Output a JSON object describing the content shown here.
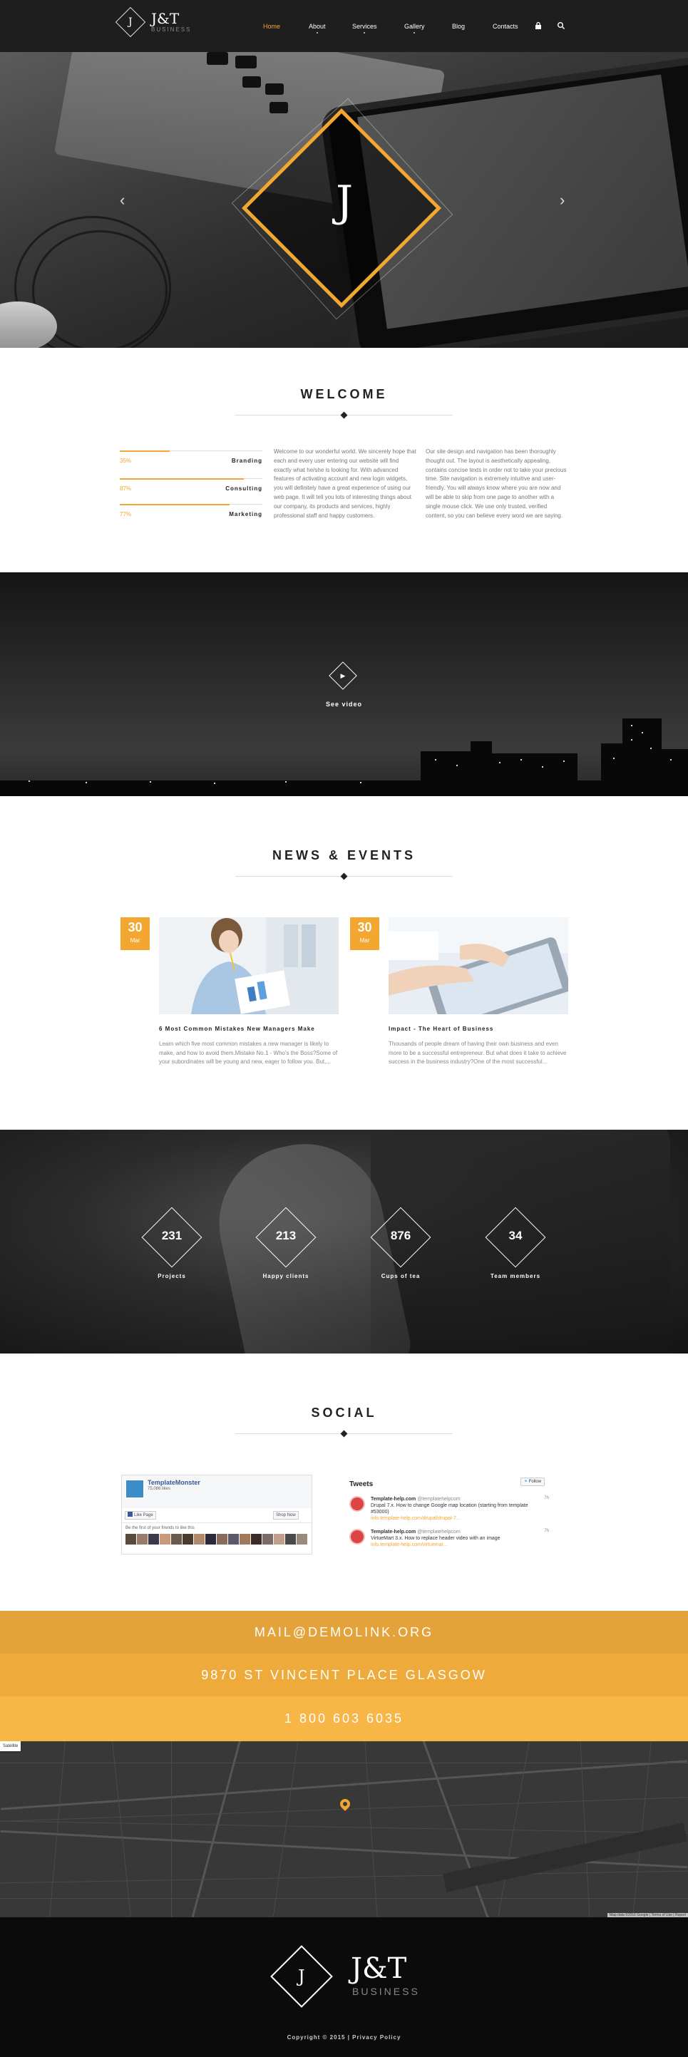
{
  "header": {
    "logo_title": "J&T",
    "logo_subtitle": "BUSINESS",
    "logo_mark": "J",
    "nav": [
      {
        "label": "Home",
        "active": true
      },
      {
        "label": "About"
      },
      {
        "label": "Services"
      },
      {
        "label": "Gallery"
      },
      {
        "label": "Blog"
      },
      {
        "label": "Contacts"
      }
    ],
    "icons": [
      "lock-icon",
      "search-icon"
    ]
  },
  "hero": {
    "mark": "J",
    "prev_icon": "chevron-left-icon",
    "next_icon": "chevron-right-icon"
  },
  "welcome": {
    "title": "WELCOME",
    "skills": [
      {
        "percent": "35%",
        "label": "Branding",
        "fill": 0.35
      },
      {
        "percent": "87%",
        "label": "Consulting",
        "fill": 0.87
      },
      {
        "percent": "77%",
        "label": "Marketing",
        "fill": 0.77
      }
    ],
    "text_left": "Welcome to our wonderful world. We sincerely hope that each and every user entering our website will find exactly what he/she is looking for. With advanced features of activating account and new login widgets, you will definitely have a great experience of using our web page. It will tell you lots of interesting things about our company, its products and services, highly professional staff and happy customers.",
    "text_right": "Our site design and navigation has been thoroughly thought out. The layout is aesthetically appealing, contains concise texts in order not to take your precious time. Site navigation is extremely intuitive and user-friendly. You will always know where you are now and will be able to skip from one page to another with a single mouse click. We use only trusted, verified content, so you can believe every word we are saying."
  },
  "video": {
    "label": "See video",
    "play_icon": "play-icon"
  },
  "news": {
    "title": "NEWS & EVENTS",
    "items": [
      {
        "day": "30",
        "month": "Mar",
        "title": "6 Most Common Mistakes New Managers Make",
        "text": "Learn which five most common mistakes a new manager is likely to make, and how to avoid them.Mistake No.1 - Who's the Boss?Some of your subordinates will be young and new, eager to follow you. But,..."
      },
      {
        "day": "30",
        "month": "Mar",
        "title": "Impact - The Heart of Business",
        "text": "Thousands of people dream of having their own business and even more to be a successful entrepreneur. But what does it take to achieve success in the business industry?One of the most successful..."
      }
    ]
  },
  "counters": [
    {
      "value": "231",
      "label": "Projects"
    },
    {
      "value": "213",
      "label": "Happy clients"
    },
    {
      "value": "876",
      "label": "Cups of tea"
    },
    {
      "value": "34",
      "label": "Team members"
    }
  ],
  "social": {
    "title": "SOCIAL",
    "facebook": {
      "page_name": "TemplateMonster",
      "likes": "75,086 likes",
      "like_button": "Like Page",
      "shop_button": "Shop Now",
      "friends_text": "Be the first of your friends to like this"
    },
    "twitter": {
      "heading": "Tweets",
      "follow_button": "Follow",
      "tweets": [
        {
          "author": "Template-help.com",
          "handle": "@templatehelpcom",
          "age": "7h",
          "text": "Drupal 7.x. How to change Google map location (starting from template #53000)",
          "link": "info.template-help.com/drupal/drupal-7..."
        },
        {
          "author": "Template-help.com",
          "handle": "@templatehelpcom",
          "age": "7h",
          "text": "VirtueMart 3.x. How to replace header video with an image",
          "link": "info.template-help.com/virtuemar..."
        }
      ]
    }
  },
  "contacts": {
    "email": "MAIL@DEMOLINK.ORG",
    "address": "9870 ST VINCENT PLACE GLASGOW",
    "phone": "1 800 603 6035",
    "colors": [
      "#e3a33a",
      "#eeab3c",
      "#f7b646"
    ]
  },
  "map": {
    "type_button": "Satellite",
    "attribution": "Map data ©2016 Google | Terms of Use | Report"
  },
  "footer": {
    "logo_title": "J&T",
    "logo_subtitle": "BUSINESS",
    "logo_mark": "J",
    "copyright": "Copyright © 2015 | Privacy Policy"
  },
  "colors": {
    "accent": "#f3a630",
    "dark": "#1e1e1e"
  }
}
